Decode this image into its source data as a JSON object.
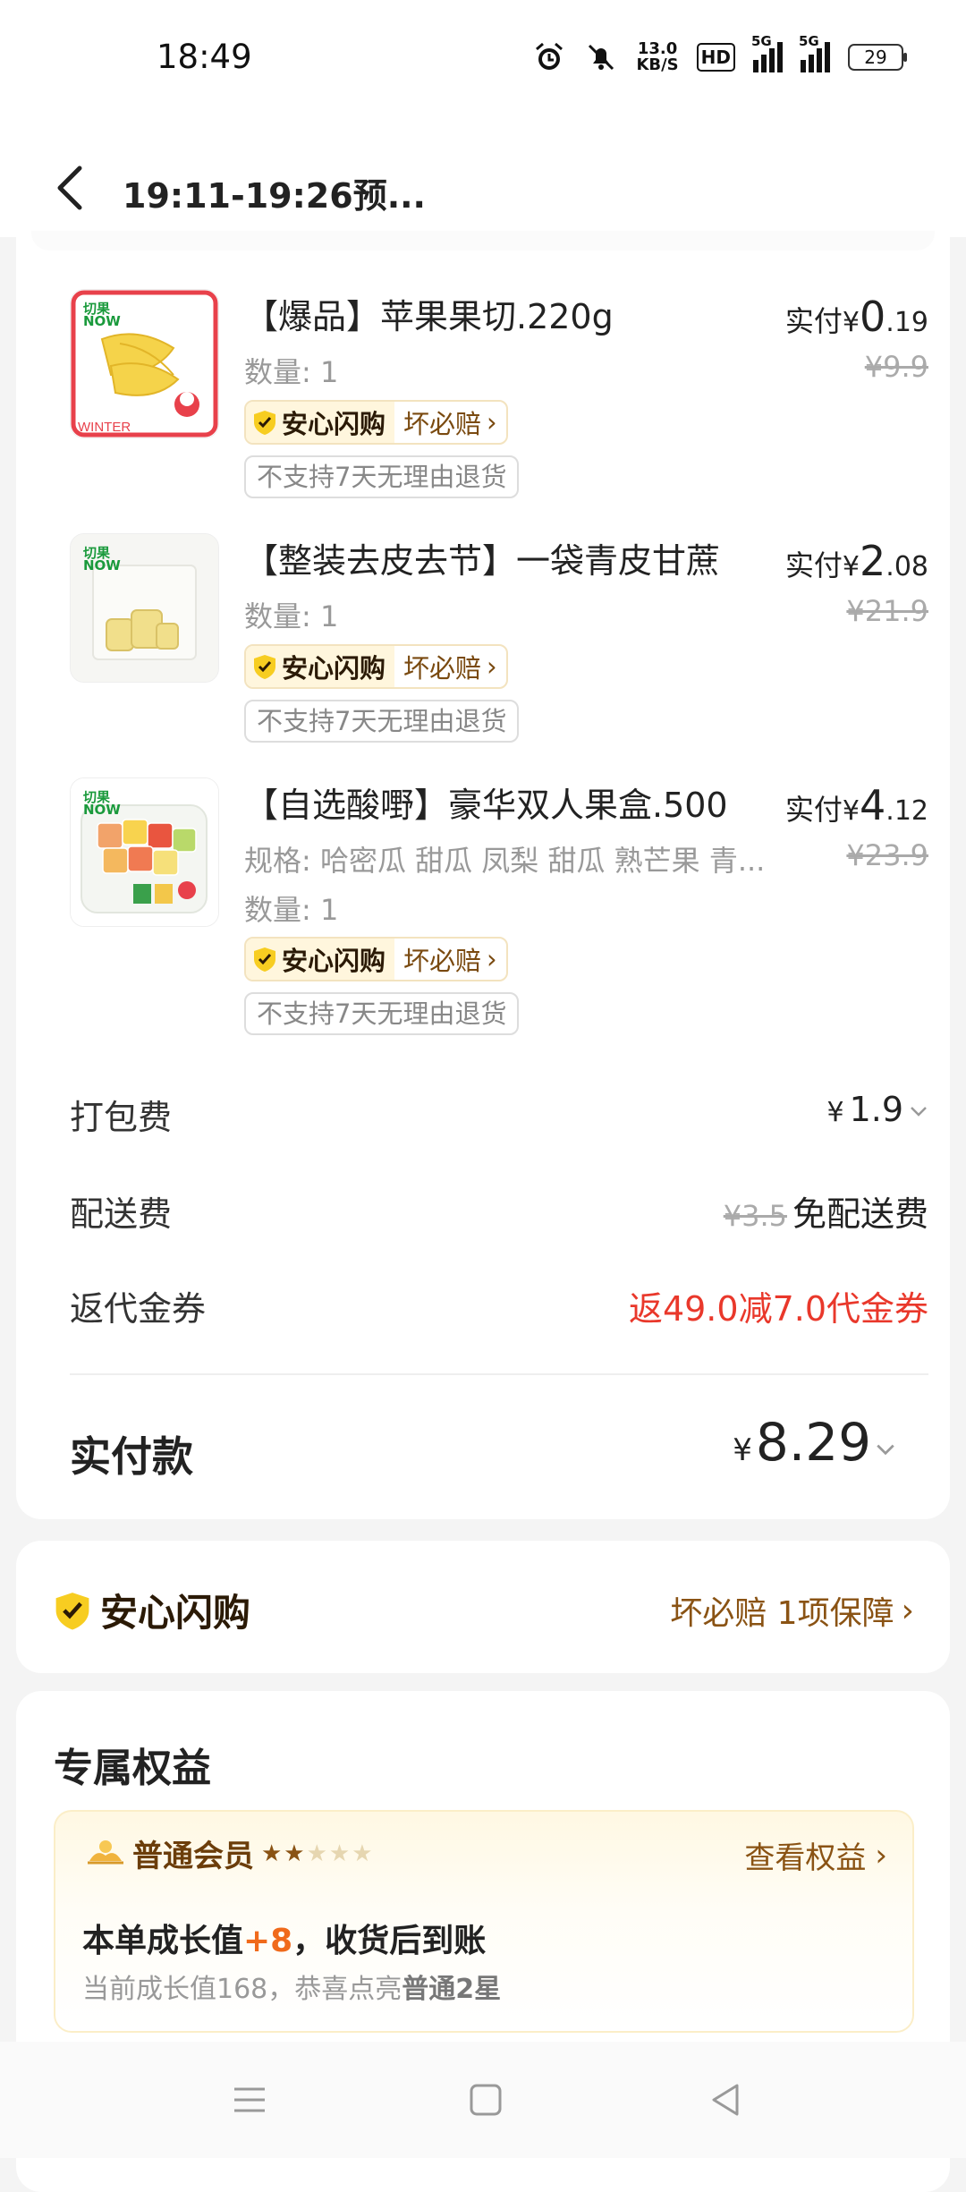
{
  "status_bar": {
    "time": "18:49",
    "net_speed_value": "13.0",
    "net_speed_unit": "KB/S",
    "hd_label": "HD",
    "sig1_label": "5G",
    "sig2_label": "5G",
    "battery": "29"
  },
  "nav": {
    "title": "19:11-19:26预..."
  },
  "items": [
    {
      "brand": "切果\nNOW",
      "name": "【爆品】苹果果切.220g",
      "pay_prefix": "实付",
      "currency": "¥",
      "price_int": "0",
      "price_dec": ".19",
      "old_price": "¥9.9",
      "quantity": "数量: 1",
      "safe_label": "安心闪购",
      "safe_right": "坏必赔",
      "return_policy": "不支持7天无理由退货"
    },
    {
      "brand": "切果\nNOW",
      "name": "【整装去皮去节】一袋青皮甘蔗",
      "pay_prefix": "实付",
      "currency": "¥",
      "price_int": "2",
      "price_dec": ".08",
      "old_price": "¥21.9",
      "quantity": "数量: 1",
      "safe_label": "安心闪购",
      "safe_right": "坏必赔",
      "return_policy": "不支持7天无理由退货"
    },
    {
      "brand": "切果\nNOW",
      "name": "【自选酸嘢】豪华双人果盒.500",
      "pay_prefix": "实付",
      "currency": "¥",
      "price_int": "4",
      "price_dec": ".12",
      "old_price": "¥23.9",
      "spec": "规格: 哈密瓜 甜瓜 凤梨 甜瓜 熟芒果 青...",
      "quantity": "数量: 1",
      "safe_label": "安心闪购",
      "safe_right": "坏必赔",
      "return_policy": "不支持7天无理由退货"
    }
  ],
  "fees": {
    "packing_label": "打包费",
    "packing_currency": "¥",
    "packing_value": "1.9",
    "delivery_label": "配送费",
    "delivery_old": "¥3.5",
    "delivery_value": "免配送费",
    "coupon_label": "返代金券",
    "coupon_value": "返49.0减7.0代金券"
  },
  "total": {
    "label": "实付款",
    "currency": "¥",
    "value": "8.29"
  },
  "safe_card": {
    "title": "安心闪购",
    "right": "坏必赔 1项保障"
  },
  "benefit": {
    "title": "专属权益",
    "member_level": "普通会员",
    "stars_on": "★★",
    "stars_off": "★★★",
    "link": "查看权益",
    "growth_prefix": "本单成长值",
    "growth_value": "+8",
    "growth_suffix": "，收货后到账",
    "growth_sub_prefix": "当前成长值168，恭喜点亮",
    "growth_sub_bold": "普通2星"
  },
  "colors": {
    "accent_red": "#e9382b",
    "gold": "#8a5314",
    "brand_green": "#1a9a3c"
  }
}
